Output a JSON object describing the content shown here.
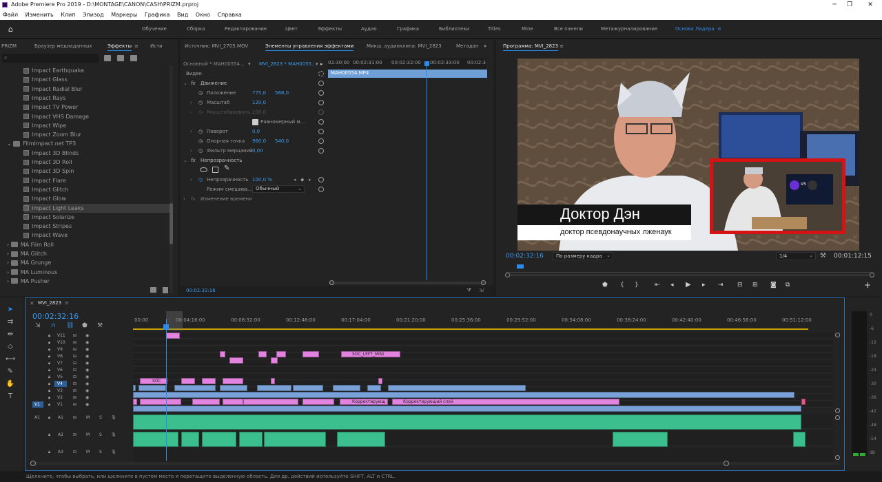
{
  "window": {
    "title": "Adobe Premiere Pro 2019 - D:\\MONTAGE\\CANON\\CASH\\PRIZM.prproj",
    "minimize": "─",
    "maximize": "❐",
    "close": "✕"
  },
  "menu": [
    "Файл",
    "Изменить",
    "Клип",
    "Эпизод",
    "Маркеры",
    "Графика",
    "Вид",
    "Окно",
    "Справка"
  ],
  "workspaces": {
    "items": [
      "Обучение",
      "Сборка",
      "Редактирование",
      "Цвет",
      "Эффекты",
      "Аудио",
      "Графика",
      "Библиотеки",
      "Titles",
      "Mine",
      "Все панели",
      "Метажурналирование",
      "Основа Лидера"
    ],
    "active": "Основа Лидера"
  },
  "effects_panel": {
    "tabs": [
      "PRIZM",
      "Браузер медиаданных",
      "Эффекты",
      "Исти"
    ],
    "active_tab": "Эффекты",
    "items": [
      {
        "label": "Impact Earthquake",
        "type": "effect"
      },
      {
        "label": "Impact Glass",
        "type": "effect"
      },
      {
        "label": "Impact Radial Blur",
        "type": "effect"
      },
      {
        "label": "Impact Rays",
        "type": "effect"
      },
      {
        "label": "Impact TV Power",
        "type": "effect"
      },
      {
        "label": "Impact VHS Damage",
        "type": "effect"
      },
      {
        "label": "Impact Wipe",
        "type": "effect"
      },
      {
        "label": "Impact Zoom Blur",
        "type": "effect"
      },
      {
        "label": "FilmImpact.net TP3",
        "type": "folder-open"
      },
      {
        "label": "Impact 3D Blinds",
        "type": "effect"
      },
      {
        "label": "Impact 3D Roll",
        "type": "effect"
      },
      {
        "label": "Impact 3D Spin",
        "type": "effect"
      },
      {
        "label": "Impact Flare",
        "type": "effect"
      },
      {
        "label": "Impact Glitch",
        "type": "effect"
      },
      {
        "label": "Impact Glow",
        "type": "effect"
      },
      {
        "label": "Impact Light Leaks",
        "type": "effect",
        "selected": true
      },
      {
        "label": "Impact Solarize",
        "type": "effect"
      },
      {
        "label": "Impact Stripes",
        "type": "effect"
      },
      {
        "label": "Impact Wave",
        "type": "effect"
      },
      {
        "label": "MA Film Roll",
        "type": "folder"
      },
      {
        "label": "MA Glitch",
        "type": "folder"
      },
      {
        "label": "MA Grunge",
        "type": "folder"
      },
      {
        "label": "MA Luminous",
        "type": "folder"
      },
      {
        "label": "MA Pusher",
        "type": "folder"
      }
    ]
  },
  "effect_controls": {
    "tabs": [
      "Источник: MVI_2705.MOV",
      "Элементы управления эффектами",
      "Микш. аудиоклипа: MVI_2823",
      "Метадан"
    ],
    "active_tab": "Элементы управления эффектами",
    "master": "Основной * MAH00554...",
    "sequence": "MVI_2823 * MAH0055...",
    "section_video": "Видео",
    "motion": "Движение",
    "position_label": "Положение",
    "position_x": "775,0",
    "position_y": "568,0",
    "scale_label": "Масштаб",
    "scale_value": "120,0",
    "scale_width_label": "Масштабировать...",
    "scale_width_value": "100,0",
    "uniform_label": "Равномерный м...",
    "rotation_label": "Поворот",
    "rotation_value": "0,0",
    "anchor_label": "Опорная точка",
    "anchor_x": "960,0",
    "anchor_y": "540,0",
    "flicker_label": "Фильтр мерцаний",
    "flicker_value": "0,00",
    "opacity_section": "Непрозрачность",
    "opacity_label": "Непрозрачность",
    "opacity_value": "100,0 %",
    "blend_label": "Режим смешива...",
    "blend_value": "Обычный",
    "time_remap": "Изменение времени",
    "ruler": [
      "02:30:00",
      "00:02:31:00",
      "00:02:32:00",
      "00:02:33:00",
      "00:02:3"
    ],
    "clip_name": "MAH00554.MP4",
    "timecode": "00:02:32:16"
  },
  "program_monitor": {
    "title": "Программа: MVI_2823",
    "timecode": "00:02:32:16",
    "fit": "По размеру кадра",
    "resolution": "1/4",
    "duration": "00:01:12:15",
    "lower_third_name": "Доктор Дэн",
    "lower_third_sub": "доктор псевдонаучных лженаук",
    "pip_badge": "VS"
  },
  "timeline": {
    "tab": "MVI_2823",
    "timecode": "00:02:32:16",
    "ruler": [
      "00:00",
      "00:04:16:00",
      "00:08:32:00",
      "00:12:48:00",
      "00:17:04:00",
      "00:21:20:00",
      "00:25:36:00",
      "00:29:52:00",
      "00:34:08:00",
      "00:38:24:00",
      "00:42:40:00",
      "00:46:56:00",
      "00:51:12:00"
    ],
    "video_tracks": [
      "V11",
      "V10",
      "V9",
      "V8",
      "V7",
      "V6",
      "V5",
      "V4",
      "V3",
      "V2",
      "V1"
    ],
    "audio_tracks": [
      "A1",
      "A2",
      "A3"
    ],
    "source_v": "V1",
    "source_a": "A1",
    "clip_labels": {
      "soc": "SOC",
      "soc_left_mini": "SOC_LEFT_MINI",
      "adj": "Корректирующ",
      "adj_full": "Корректирующий слой"
    },
    "mute": "M",
    "solo": "S"
  },
  "meter_scale": [
    "0",
    "-6",
    "-12",
    "-18",
    "-24",
    "-30",
    "-36",
    "-42",
    "-48",
    "-54",
    "dB"
  ],
  "status": "Щелкните, чтобы выбрать, или щелкните в пустом месте и перетащите выделенную область. Для др. действий используйте SHIFT, ALT и CTRL.",
  "colors": {
    "accent": "#2d8ceb",
    "video_clip": "#e383e0",
    "audio_clip": "#3cbf8f",
    "timecode": "#3b9bf0"
  }
}
